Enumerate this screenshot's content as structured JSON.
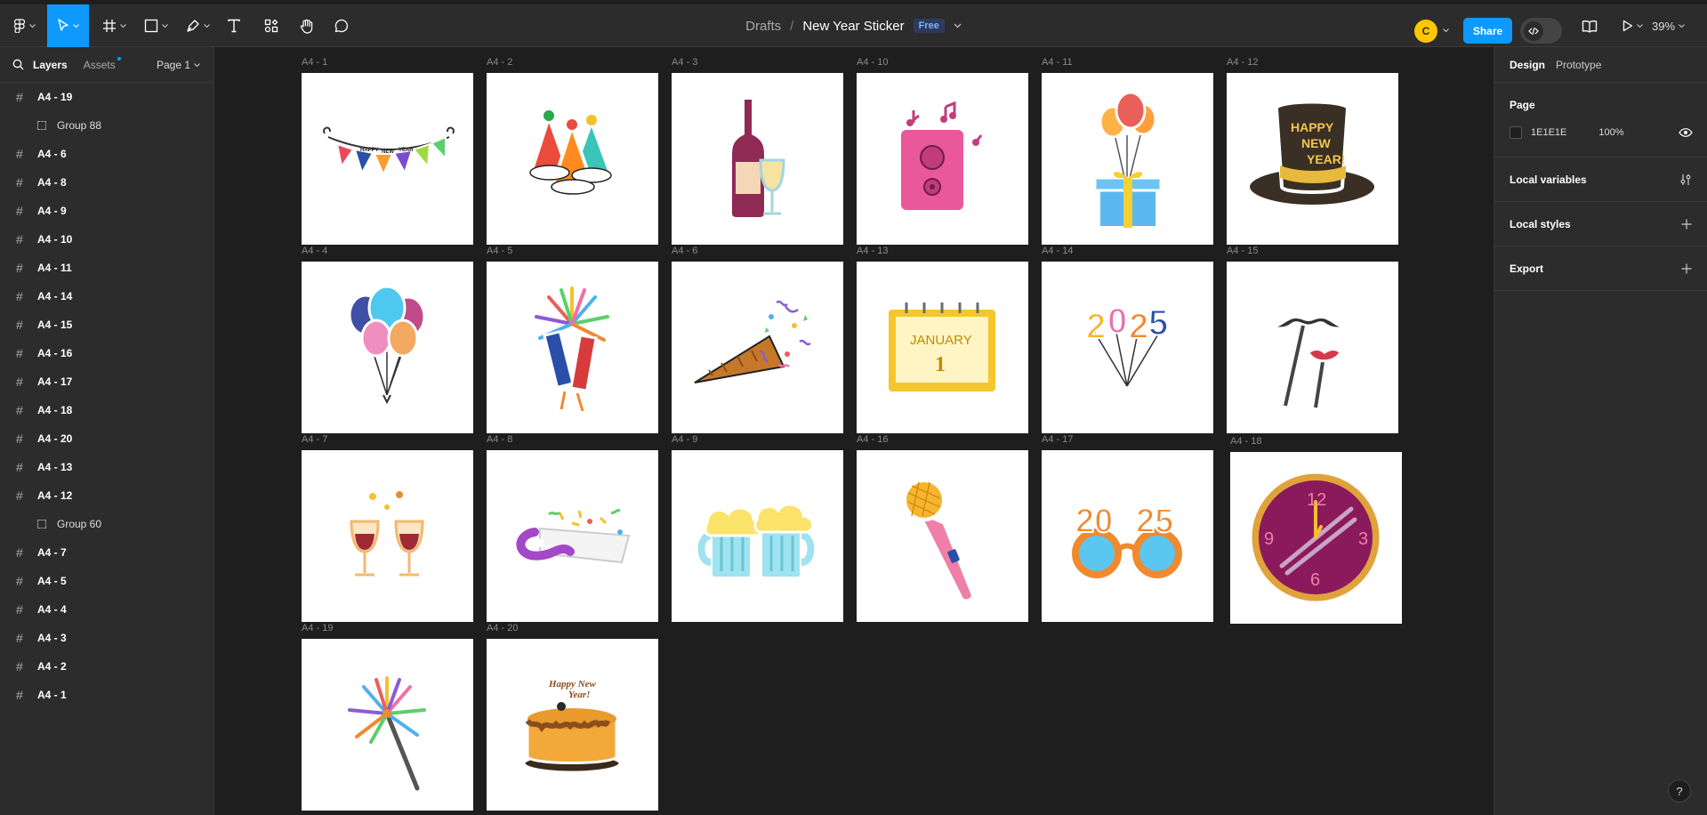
{
  "toolbar": {
    "breadcrumb_drafts": "Drafts",
    "breadcrumb_sep": "/",
    "file_name": "New Year Sticker",
    "plan_badge": "Free",
    "avatar_initial": "C",
    "share_label": "Share",
    "zoom": "39%",
    "accent": "#0d99ff"
  },
  "left_panel": {
    "tabs": [
      "Layers",
      "Assets"
    ],
    "page_select": "Page 1",
    "layers": [
      {
        "label": "A4 - 19",
        "kind": "frame"
      },
      {
        "label": "Group 88",
        "kind": "group"
      },
      {
        "label": "A4 - 6",
        "kind": "frame"
      },
      {
        "label": "A4 - 8",
        "kind": "frame"
      },
      {
        "label": "A4 - 9",
        "kind": "frame"
      },
      {
        "label": "A4 - 10",
        "kind": "frame"
      },
      {
        "label": "A4 - 11",
        "kind": "frame"
      },
      {
        "label": "A4 - 14",
        "kind": "frame"
      },
      {
        "label": "A4 - 15",
        "kind": "frame"
      },
      {
        "label": "A4 - 16",
        "kind": "frame"
      },
      {
        "label": "A4 - 17",
        "kind": "frame"
      },
      {
        "label": "A4 - 18",
        "kind": "frame"
      },
      {
        "label": "A4 - 20",
        "kind": "frame"
      },
      {
        "label": "A4 - 13",
        "kind": "frame"
      },
      {
        "label": "A4 - 12",
        "kind": "frame"
      },
      {
        "label": "Group 60",
        "kind": "group"
      },
      {
        "label": "A4 - 7",
        "kind": "frame"
      },
      {
        "label": "A4 - 5",
        "kind": "frame"
      },
      {
        "label": "A4 - 4",
        "kind": "frame"
      },
      {
        "label": "A4 - 3",
        "kind": "frame"
      },
      {
        "label": "A4 - 2",
        "kind": "frame"
      },
      {
        "label": "A4 - 1",
        "kind": "frame"
      }
    ]
  },
  "right_panel": {
    "tabs": [
      "Design",
      "Prototype"
    ],
    "page_section": "Page",
    "page_fill_hex": "1E1E1E",
    "page_fill_opacity": "100%",
    "local_variables": "Local variables",
    "local_styles": "Local styles",
    "export": "Export",
    "help": "?"
  },
  "canvas": {
    "background": "#1e1e1e",
    "frames": [
      {
        "label": "A4 - 1",
        "sticker": "happy-new-year-bunting",
        "bunting_text": [
          "HAPPY",
          "NEW",
          "YEAR"
        ]
      },
      {
        "label": "A4 - 2",
        "sticker": "party-hats"
      },
      {
        "label": "A4 - 3",
        "sticker": "wine-bottle-and-glass"
      },
      {
        "label": "A4 - 10",
        "sticker": "pink-speaker-with-notes"
      },
      {
        "label": "A4 - 11",
        "sticker": "balloons-gift-box"
      },
      {
        "label": "A4 - 12",
        "sticker": "top-hat",
        "hat_text": [
          "HAPPY",
          "NEW",
          "YEAR!"
        ]
      },
      {
        "label": "A4 - 4",
        "sticker": "balloon-bunch"
      },
      {
        "label": "A4 - 5",
        "sticker": "firework-rockets"
      },
      {
        "label": "A4 - 6",
        "sticker": "party-popper-confetti"
      },
      {
        "label": "A4 - 13",
        "sticker": "calendar-january-1",
        "calendar_month": "JANUARY",
        "calendar_day": "1"
      },
      {
        "label": "A4 - 14",
        "sticker": "2025-balloons",
        "year_digits": [
          "2",
          "0",
          "2",
          "5"
        ]
      },
      {
        "label": "A4 - 15",
        "sticker": "mustache-lips-props"
      },
      {
        "label": "A4 - 7",
        "sticker": "wine-toast"
      },
      {
        "label": "A4 - 8",
        "sticker": "party-horn"
      },
      {
        "label": "A4 - 9",
        "sticker": "beer-mugs-toast"
      },
      {
        "label": "A4 - 16",
        "sticker": "microphone"
      },
      {
        "label": "A4 - 17",
        "sticker": "2025-glasses",
        "glasses_text": [
          "20",
          "25"
        ]
      },
      {
        "label": "A4 - 18",
        "sticker": "clock",
        "clock_numbers": [
          "12",
          "3",
          "6",
          "9"
        ]
      },
      {
        "label": "A4 - 19",
        "sticker": "sparkler"
      },
      {
        "label": "A4 - 20",
        "sticker": "happy-new-year-cake",
        "cake_text": [
          "Happy New",
          "Year!"
        ]
      }
    ]
  }
}
